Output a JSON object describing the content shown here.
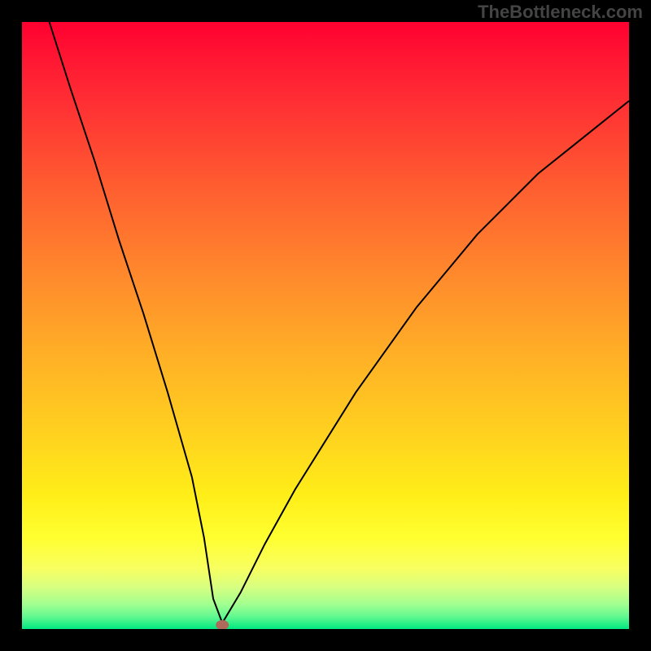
{
  "watermark": "TheBottleneck.com",
  "chart_data": {
    "type": "line",
    "title": "",
    "xlabel": "",
    "ylabel": "",
    "xlim": [
      0,
      100
    ],
    "ylim": [
      0,
      100
    ],
    "grid": false,
    "series": [
      {
        "name": "bottleneck-curve",
        "x": [
          4.5,
          8,
          12,
          16,
          20,
          24,
          28,
          30,
          31.5,
          33,
          36,
          40,
          45,
          50,
          55,
          60,
          65,
          70,
          75,
          80,
          85,
          90,
          95,
          100
        ],
        "y": [
          100,
          89,
          77,
          64,
          52,
          39,
          25,
          15,
          5,
          1,
          6,
          14,
          23,
          31,
          39,
          46,
          53,
          59,
          65,
          70,
          75,
          79,
          83,
          87
        ]
      }
    ],
    "annotations": [
      {
        "name": "min-marker",
        "x": 33,
        "y": 0.5
      }
    ],
    "background_gradient": {
      "top": "#ff0030",
      "upper_mid": "#ffb026",
      "lower_mid": "#ffff30",
      "bottom": "#00e880"
    }
  }
}
